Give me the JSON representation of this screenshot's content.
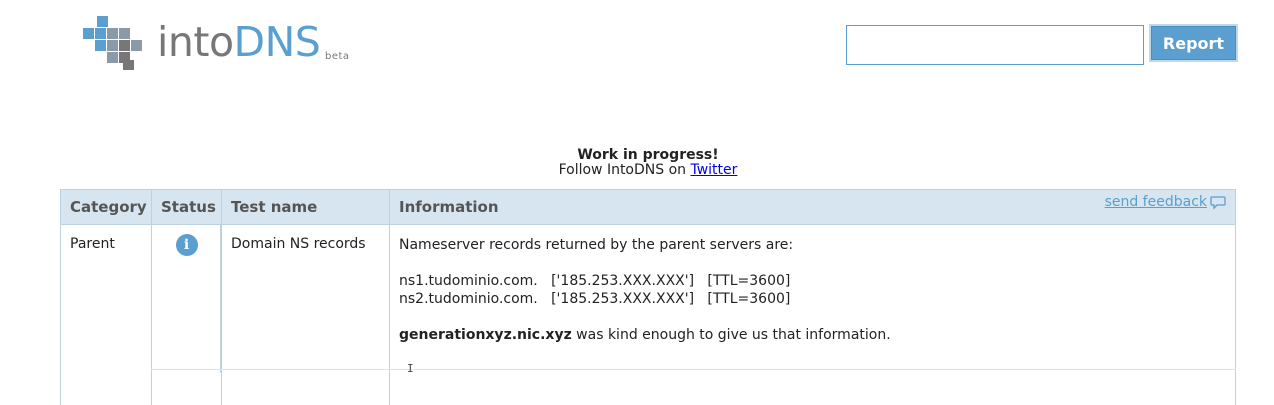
{
  "logo": {
    "text_into": "into",
    "text_dns": "DNS",
    "beta": "beta",
    "colors": {
      "grey": "#777777",
      "blue": "#5a9fcf"
    }
  },
  "search": {
    "value": "",
    "placeholder": "",
    "button_label": "Report"
  },
  "notice": {
    "title": "Work in progress!",
    "follow_prefix": "Follow IntoDNS on ",
    "twitter_link": "Twitter"
  },
  "table": {
    "headers": {
      "category": "Category",
      "status": "Status",
      "test": "Test name",
      "information": "Information"
    },
    "feedback_link": "send feedback",
    "rows": [
      {
        "category": "Parent",
        "status_icon": "info-icon",
        "status_glyph": "i",
        "test": "Domain NS records",
        "info_intro": "Nameserver records returned by the parent servers are:",
        "ns_records": [
          "ns1.tudominio.com.   ['185.253.XXX.XXX']   [TTL=3600]",
          "ns2.tudominio.com.   ['185.253.XXX.XXX']   [TTL=3600]"
        ],
        "source_server": "generationxyz.nic.xyz",
        "source_suffix": " was kind enough to give us that information."
      }
    ]
  },
  "accent_color": "#5a9fcf",
  "header_bg": "#d6e5ef"
}
